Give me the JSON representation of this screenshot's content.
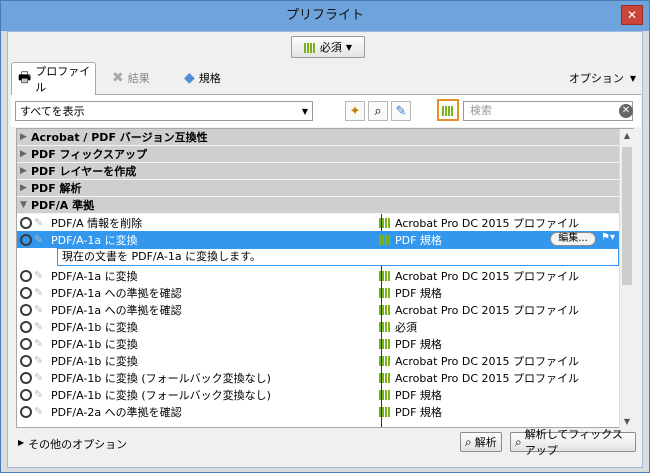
{
  "window": {
    "title": "プリフライト",
    "close": "✕"
  },
  "top_dropdown": {
    "selected": "必須"
  },
  "tabs": [
    {
      "label": "プロファイル"
    },
    {
      "label": "結果"
    },
    {
      "label": "規格"
    }
  ],
  "options_label": "オプション",
  "toolbar": {
    "show_all": "すべてを表示",
    "search_placeholder": "検索"
  },
  "categories": [
    "Acrobat / PDF バージョン互換性",
    "PDF フィックスアップ",
    "PDF レイヤーを作成",
    "PDF 解析",
    "PDF/A 準拠"
  ],
  "items": [
    {
      "name": "PDF/A 情報を削除",
      "cond": "Acrobat Pro DC 2015 プロファイル"
    },
    {
      "name": "PDF/A-1a に変換",
      "cond": "PDF 規格",
      "selected": true
    },
    {
      "name": "PDF/A-1a に変換",
      "cond": "Acrobat Pro DC 2015 プロファイル"
    },
    {
      "name": "PDF/A-1a への準拠を確認",
      "cond": "PDF 規格"
    },
    {
      "name": "PDF/A-1a への準拠を確認",
      "cond": "Acrobat Pro DC 2015 プロファイル"
    },
    {
      "name": "PDF/A-1b に変換",
      "cond": "必須"
    },
    {
      "name": "PDF/A-1b に変換",
      "cond": "PDF 規格"
    },
    {
      "name": "PDF/A-1b に変換",
      "cond": "Acrobat Pro DC 2015 プロファイル"
    },
    {
      "name": "PDF/A-1b に変換 (フォールバック変換なし)",
      "cond": "Acrobat Pro DC 2015 プロファイル"
    },
    {
      "name": "PDF/A-1b に変換 (フォールバック変換なし)",
      "cond": "PDF 規格"
    },
    {
      "name": "PDF/A-2a への準拠を確認",
      "cond": "PDF 規格"
    }
  ],
  "selected_desc": "現在の文書を PDF/A-1a に変換します。",
  "edit_label": "編集...",
  "more_options": "その他のオプション",
  "buttons": {
    "analyze": "解析",
    "analyze_fix": "解析してフィックスアップ"
  }
}
